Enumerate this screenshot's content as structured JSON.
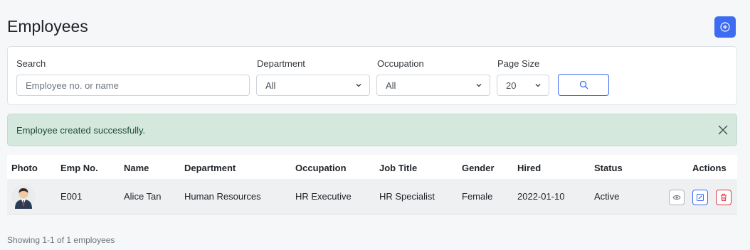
{
  "header": {
    "title": "Employees"
  },
  "filters": {
    "search_label": "Search",
    "search_placeholder": "Employee no. or name",
    "department_label": "Department",
    "department_value": "All",
    "occupation_label": "Occupation",
    "occupation_value": "All",
    "page_size_label": "Page Size",
    "page_size_value": "20"
  },
  "alert": {
    "message": "Employee created successfully."
  },
  "table": {
    "headers": [
      "Photo",
      "Emp No.",
      "Name",
      "Department",
      "Occupation",
      "Job Title",
      "Gender",
      "Hired",
      "Status",
      "Actions"
    ],
    "rows": [
      {
        "emp_no": "E001",
        "name": "Alice Tan",
        "department": "Human Resources",
        "occupation": "HR Executive",
        "job_title": "HR Specialist",
        "gender": "Female",
        "hired": "2022-01-10",
        "status": "Active"
      }
    ]
  },
  "footer": {
    "summary": "Showing 1-1 of 1 employees"
  },
  "colors": {
    "primary": "#3d6bf2",
    "danger": "#dc3545",
    "success_bg": "#d4e8de"
  },
  "icons": {
    "add": "plus-circle-icon",
    "search": "search-icon",
    "close": "close-icon",
    "view": "eye-icon",
    "edit": "edit-icon",
    "delete": "trash-icon"
  }
}
